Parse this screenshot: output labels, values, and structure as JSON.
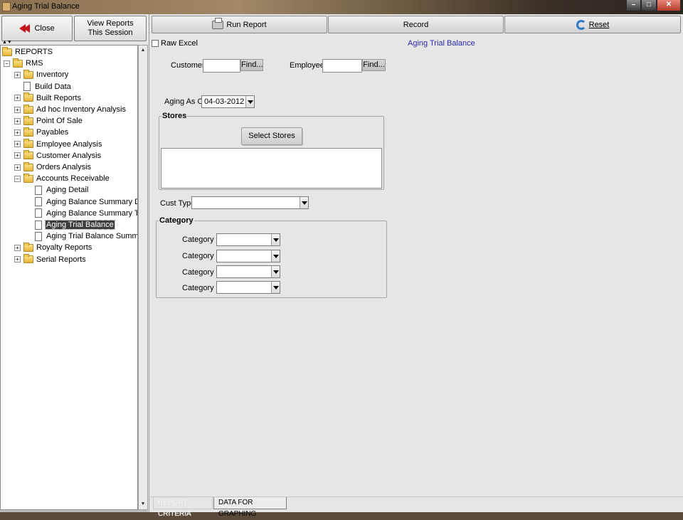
{
  "window": {
    "title": "Aging Trial Balance",
    "controls": {
      "minimize": "–",
      "maximize": "□",
      "close": "✕"
    }
  },
  "left": {
    "close_label": "Close",
    "view_reports_line1": "View Reports",
    "view_reports_line2": "This Session",
    "tree": [
      {
        "label": "REPORTS",
        "type": "folder-open",
        "expander": "",
        "level": 0
      },
      {
        "label": "RMS",
        "type": "folder-open",
        "expander": "−",
        "level": 1
      },
      {
        "label": "Inventory",
        "type": "folder",
        "expander": "+",
        "level": 2
      },
      {
        "label": "Build Data",
        "type": "doc",
        "expander": "",
        "level": 2
      },
      {
        "label": "Built Reports",
        "type": "folder",
        "expander": "+",
        "level": 2
      },
      {
        "label": "Ad hoc Inventory  Analysis",
        "type": "folder",
        "expander": "+",
        "level": 2
      },
      {
        "label": "Point Of Sale",
        "type": "folder",
        "expander": "+",
        "level": 2
      },
      {
        "label": "Payables",
        "type": "folder",
        "expander": "+",
        "level": 2
      },
      {
        "label": "Employee Analysis",
        "type": "folder",
        "expander": "+",
        "level": 2
      },
      {
        "label": "Customer Analysis",
        "type": "folder",
        "expander": "+",
        "level": 2
      },
      {
        "label": "Orders Analysis",
        "type": "folder",
        "expander": "+",
        "level": 2
      },
      {
        "label": "Accounts Receivable",
        "type": "folder-open",
        "expander": "−",
        "level": 2
      },
      {
        "label": "Aging Detail",
        "type": "doc",
        "expander": "",
        "level": 3
      },
      {
        "label": "Aging Balance Summary Detail",
        "type": "doc",
        "expander": "",
        "level": 3
      },
      {
        "label": "Aging Balance Summary Totals",
        "type": "doc",
        "expander": "",
        "level": 3
      },
      {
        "label": "Aging Trial Balance",
        "type": "doc",
        "expander": "",
        "level": 3,
        "selected": true
      },
      {
        "label": "Aging Trial Balance Summary",
        "type": "doc",
        "expander": "",
        "level": 3
      },
      {
        "label": "Royalty Reports",
        "type": "folder",
        "expander": "+",
        "level": 2
      },
      {
        "label": "Serial Reports",
        "type": "folder",
        "expander": "+",
        "level": 2
      }
    ]
  },
  "toolbar": {
    "run_label": "Run Report",
    "record_label": "Record",
    "reset_label": "Reset"
  },
  "form": {
    "raw_excel_label": "Raw Excel",
    "report_title": "Aging Trial Balance",
    "customer_label": "Customer",
    "customer_value": "",
    "employee_label": "Employee",
    "employee_value": "",
    "find_label": "Find...",
    "aging_as_of_label": "Aging As Of",
    "aging_as_of_value": "04-03-2012",
    "stores_title": "Stores",
    "select_stores_label": "Select Stores",
    "cust_type_label": "Cust Type",
    "cust_type_value": "",
    "category_title": "Category",
    "categories": [
      {
        "label": "Category 1",
        "value": ""
      },
      {
        "label": "Category 2",
        "value": ""
      },
      {
        "label": "Category 3",
        "value": ""
      },
      {
        "label": "Category 4",
        "value": ""
      }
    ]
  },
  "tabs": [
    {
      "label": "REPORT CRITERIA",
      "active": true
    },
    {
      "label": "DATA FOR GRAPHING",
      "active": false
    }
  ]
}
